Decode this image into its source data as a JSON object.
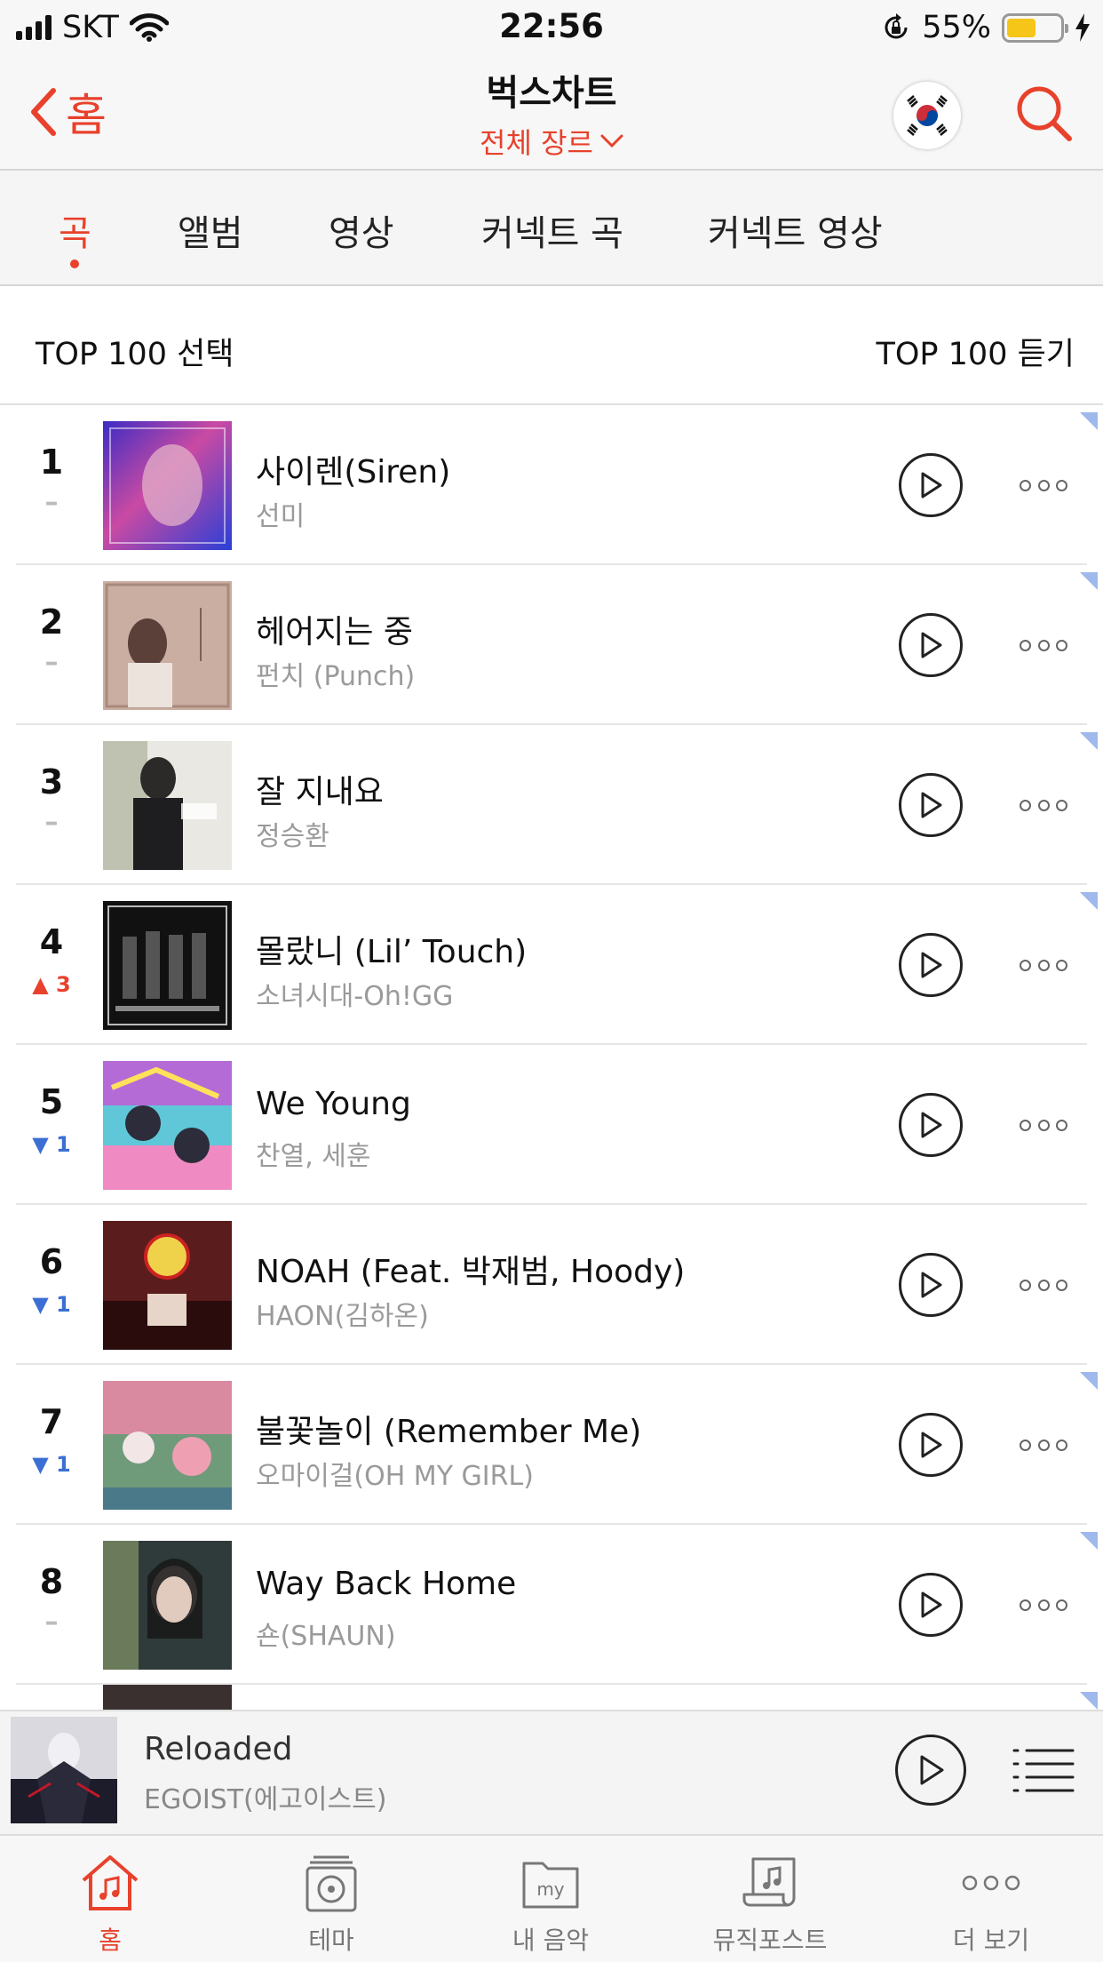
{
  "status_bar": {
    "carrier": "SKT",
    "time": "22:56",
    "battery": "55%",
    "battery_level": 0.55
  },
  "nav": {
    "back_label": "홈",
    "title": "벅스차트",
    "genre": "전체 장르"
  },
  "tabs": [
    {
      "label": "곡",
      "active": true
    },
    {
      "label": "앨범",
      "active": false
    },
    {
      "label": "영상",
      "active": false
    },
    {
      "label": "커넥트 곡",
      "active": false
    },
    {
      "label": "커넥트 영상",
      "active": false
    }
  ],
  "top100": {
    "select_label": "TOP 100 선택",
    "play_label": "TOP 100 듣기"
  },
  "chart": [
    {
      "rank": "1",
      "change": "–",
      "change_type": "same",
      "title": "사이렌(Siren)",
      "artist": "선미"
    },
    {
      "rank": "2",
      "change": "–",
      "change_type": "same",
      "title": "헤어지는 중",
      "artist": "펀치 (Punch)"
    },
    {
      "rank": "3",
      "change": "–",
      "change_type": "same",
      "title": "잘 지내요",
      "artist": "정승환"
    },
    {
      "rank": "4",
      "change": "3",
      "change_type": "up",
      "title": "몰랐니 (Lil’ Touch)",
      "artist": "소녀시대-Oh!GG"
    },
    {
      "rank": "5",
      "change": "1",
      "change_type": "down",
      "title": "We Young",
      "artist": "찬열, 세훈"
    },
    {
      "rank": "6",
      "change": "1",
      "change_type": "down",
      "title": "NOAH (Feat. 박재범, Hoody)",
      "artist": "HAON(김하온)"
    },
    {
      "rank": "7",
      "change": "1",
      "change_type": "down",
      "title": "불꽃놀이 (Remember Me)",
      "artist": "오마이걸(OH MY GIRL)"
    },
    {
      "rank": "8",
      "change": "–",
      "change_type": "same",
      "title": "Way Back Home",
      "artist": "숀(SHAUN)"
    }
  ],
  "mini_player": {
    "title": "Reloaded",
    "artist": "EGOIST(에고이스트)"
  },
  "tab_bar": [
    {
      "label": "홈",
      "icon": "home-music-icon",
      "active": true
    },
    {
      "label": "테마",
      "icon": "theme-disc-icon",
      "active": false
    },
    {
      "label": "내 음악",
      "icon": "my-folder-icon",
      "active": false
    },
    {
      "label": "뮤직포스트",
      "icon": "music-post-icon",
      "active": false
    },
    {
      "label": "더 보기",
      "icon": "more-dots-icon",
      "active": false
    }
  ],
  "colors": {
    "accent": "#e8412c",
    "rank_down": "#3b6fd4",
    "new_marker": "#9fb9ec"
  }
}
